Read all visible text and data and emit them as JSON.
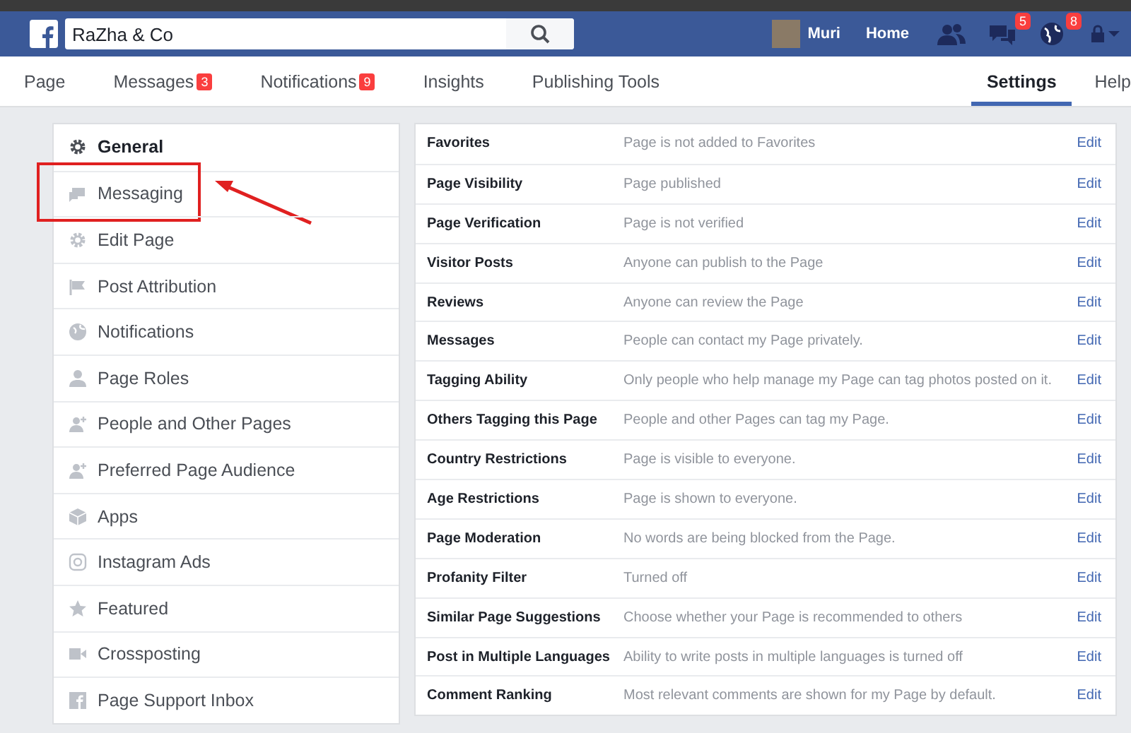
{
  "top_bar": {
    "search": {
      "value": "RaZha & Co"
    },
    "profile_name": "Muri",
    "home": "Home",
    "messages_badge": "5",
    "notifications_badge": "8"
  },
  "tabs": [
    {
      "label": "Page",
      "selected": false
    },
    {
      "label": "Messages",
      "badge": "3",
      "selected": false
    },
    {
      "label": "Notifications",
      "badge": "9",
      "selected": false
    },
    {
      "label": "Insights",
      "selected": false
    },
    {
      "label": "Publishing Tools",
      "selected": false
    },
    {
      "label": "Settings",
      "selected": true
    },
    {
      "label": "Help",
      "selected": false
    }
  ],
  "sidebar": {
    "items": [
      {
        "label": "General",
        "selected": true,
        "highlighted": false
      },
      {
        "label": "Messaging",
        "selected": false,
        "highlighted": true
      },
      {
        "label": "Edit Page",
        "selected": false,
        "highlighted": false
      },
      {
        "label": "Post Attribution",
        "selected": false,
        "highlighted": false
      },
      {
        "label": "Notifications",
        "selected": false,
        "highlighted": false
      },
      {
        "label": "Page Roles",
        "selected": false,
        "highlighted": false
      },
      {
        "label": "People and Other Pages",
        "selected": false,
        "highlighted": false
      },
      {
        "label": "Preferred Page Audience",
        "selected": false,
        "highlighted": false
      },
      {
        "label": "Apps",
        "selected": false,
        "highlighted": false
      },
      {
        "label": "Instagram Ads",
        "selected": false,
        "highlighted": false
      },
      {
        "label": "Featured",
        "selected": false,
        "highlighted": false
      },
      {
        "label": "Crossposting",
        "selected": false,
        "highlighted": false
      },
      {
        "label": "Page Support Inbox",
        "selected": false,
        "highlighted": false
      }
    ]
  },
  "settings": {
    "rows": [
      {
        "name": "Favorites",
        "value": "Page is not added to Favorites",
        "action": "Edit"
      },
      {
        "name": "Page Visibility",
        "value": "Page published",
        "action": "Edit"
      },
      {
        "name": "Page Verification",
        "value": "Page is not verified",
        "action": "Edit"
      },
      {
        "name": "Visitor Posts",
        "value": "Anyone can publish to the Page",
        "action": "Edit"
      },
      {
        "name": "Reviews",
        "value": "Anyone can review the Page",
        "action": "Edit"
      },
      {
        "name": "Messages",
        "value": "People can contact my Page privately.",
        "action": "Edit"
      },
      {
        "name": "Tagging Ability",
        "value": "Only people who help manage my Page can tag photos posted on it.",
        "action": "Edit"
      },
      {
        "name": "Others Tagging this Page",
        "value": "People and other Pages can tag my Page.",
        "action": "Edit"
      },
      {
        "name": "Country Restrictions",
        "value": "Page is visible to everyone.",
        "action": "Edit"
      },
      {
        "name": "Age Restrictions",
        "value": "Page is shown to everyone.",
        "action": "Edit"
      },
      {
        "name": "Page Moderation",
        "value": "No words are being blocked from the Page.",
        "action": "Edit"
      },
      {
        "name": "Profanity Filter",
        "value": "Turned off",
        "action": "Edit"
      },
      {
        "name": "Similar Page Suggestions",
        "value": "Choose whether your Page is recommended to others",
        "action": "Edit"
      },
      {
        "name": "Post in Multiple Languages",
        "value": "Ability to write posts in multiple languages is turned off",
        "action": "Edit"
      },
      {
        "name": "Comment Ranking",
        "value": "Most relevant comments are shown for my Page by default.",
        "action": "Edit"
      }
    ]
  }
}
